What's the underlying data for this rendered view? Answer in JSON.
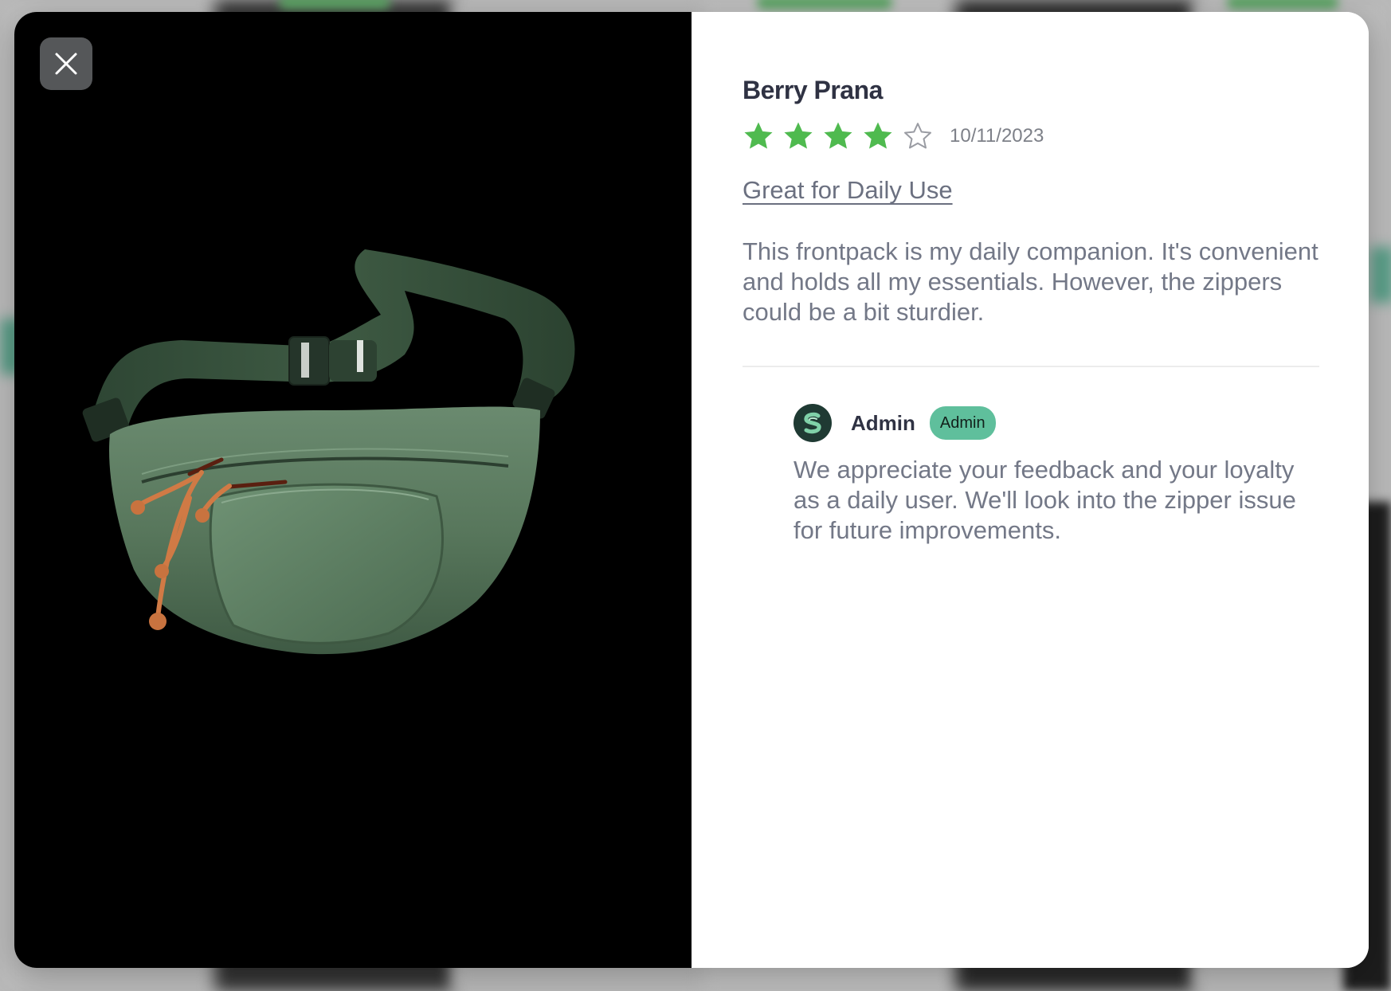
{
  "review": {
    "reviewer_name": "Berry Prana",
    "rating": 4,
    "rating_max": 5,
    "date": "10/11/2023",
    "title": "Great for Daily Use",
    "body": "This frontpack is my daily companion. It's convenient and holds all my essentials. However, the zippers could be a bit sturdier."
  },
  "reply": {
    "author": "Admin",
    "badge": "Admin",
    "body": "We appreciate your feedback and your loyalty as a daily user. We'll look into the zipper issue for future improvements."
  },
  "media": {
    "product": "green waist bag with orange drawcords",
    "background_color": "#000000"
  },
  "icons": {
    "close": "close-icon",
    "star_filled": "star-filled-icon",
    "star_empty": "star-empty-icon",
    "avatar": "brand-logo-icon"
  },
  "colors": {
    "star_filled": "#4fba4f",
    "star_empty": "#9a9ca3",
    "badge": "#5fbf9c",
    "text_heading": "#2f3243",
    "text_body": "#737887"
  }
}
